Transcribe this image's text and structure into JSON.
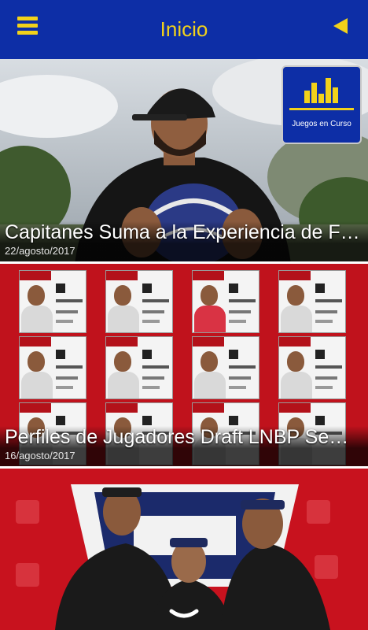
{
  "appbar": {
    "title": "Inicio",
    "menu_icon": "hamburger-menu-icon",
    "back_icon": "triangle-left-icon",
    "accent_color": "#f2d21a",
    "bar_color": "#0d2ea6"
  },
  "juegos_button": {
    "label": "Juegos en Curso",
    "icon": "bar-chart-icon"
  },
  "feed": {
    "articles": [
      {
        "headline": "Capitanes Suma a la Experiencia de F…",
        "date": "22/agosto/2017"
      },
      {
        "headline": "Perfiles de Jugadores Draft LNBP Se…",
        "date": "16/agosto/2017"
      },
      {
        "headline": "",
        "date": ""
      }
    ]
  },
  "scroll_icon": "chevron-down-icon"
}
